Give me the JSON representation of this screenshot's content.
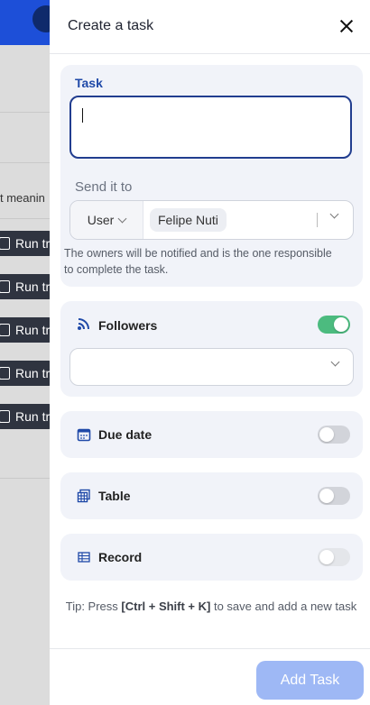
{
  "background": {
    "meaning_text": "t meanin",
    "run_buttons": [
      "Run tr",
      "Run tr",
      "Run tr",
      "Run tr",
      "Run tr"
    ]
  },
  "panel": {
    "title": "Create a task",
    "task": {
      "label": "Task",
      "value": ""
    },
    "send_to": {
      "label": "Send it to",
      "type_select": "User",
      "selected_user": "Felipe Nuti",
      "hint": "The owners will be notified and is the one responsible to complete the task."
    },
    "followers": {
      "label": "Followers",
      "enabled": true,
      "value": ""
    },
    "due_date": {
      "label": "Due date",
      "enabled": false
    },
    "table": {
      "label": "Table",
      "enabled": false
    },
    "record": {
      "label": "Record",
      "enabled": false
    },
    "tip": {
      "prefix": "Tip: Press ",
      "shortcut": "[Ctrl + Shift + K]",
      "suffix": " to save and add a new task"
    },
    "submit_label": "Add Task"
  },
  "colors": {
    "accent": "#213d8f",
    "toggle_on": "#4cbb7f",
    "button": "#9eb8f5"
  }
}
